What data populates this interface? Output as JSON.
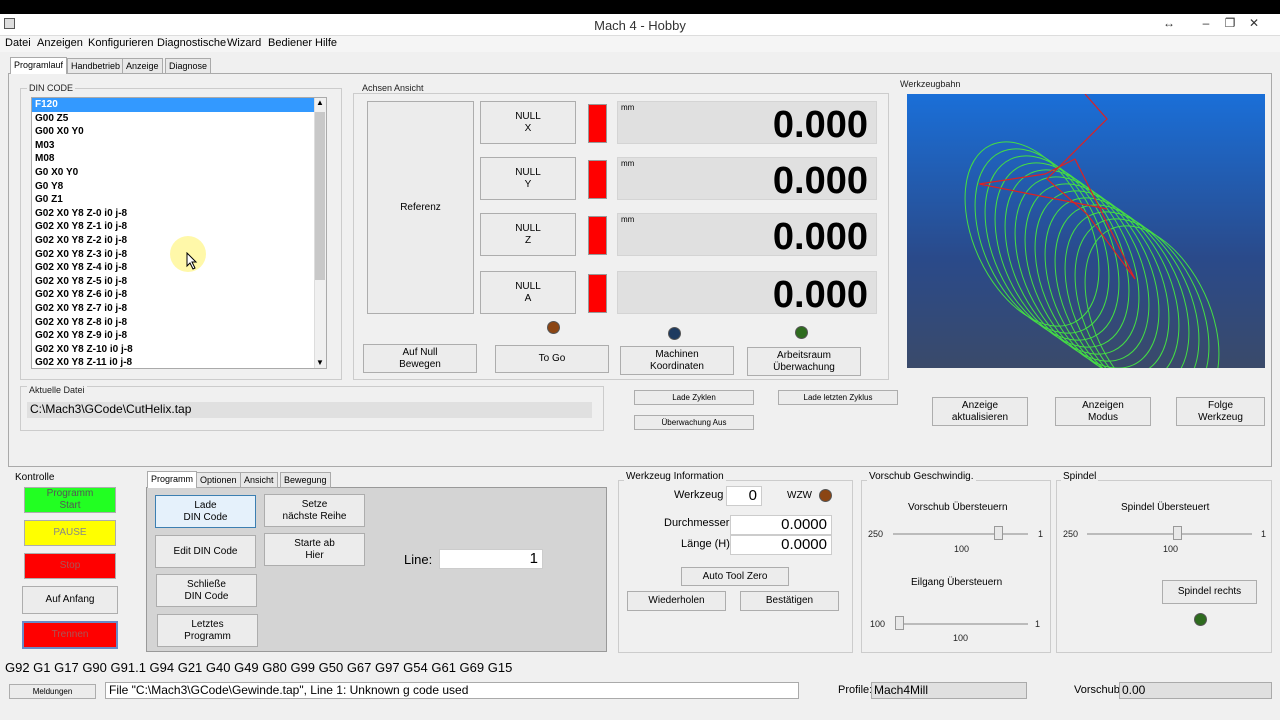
{
  "app": {
    "title": "Mach 4 - Hobby"
  },
  "menu": [
    "Datei",
    "Anzeigen",
    "Konfigurieren",
    "Diagnostische",
    "Wizard",
    "Bediener",
    "Hilfe"
  ],
  "main_tabs": [
    "Programlauf",
    "Handbetrieb",
    "Anzeige",
    "Diagnose"
  ],
  "gcode": {
    "label": "DIN CODE",
    "lines": [
      "F120",
      "G00 Z5",
      "G00 X0 Y0",
      "M03",
      "M08",
      "G0 X0 Y0",
      "G0 Y8",
      "G0 Z1",
      "G02 X0 Y8 Z-0 i0 j-8",
      "G02 X0 Y8 Z-1 i0 j-8",
      "G02 X0 Y8 Z-2 i0 j-8",
      "G02 X0 Y8 Z-3 i0 j-8",
      "G02 X0 Y8 Z-4 i0 j-8",
      "G02 X0 Y8 Z-5 i0 j-8",
      "G02 X0 Y8 Z-6 i0 j-8",
      "G02 X0 Y8 Z-7 i0 j-8",
      "G02 X0 Y8 Z-8 i0 j-8",
      "G02 X0 Y8 Z-9 i0 j-8",
      "G02 X0 Y8 Z-10 i0 j-8",
      "G02 X0 Y8 Z-11 i0 j-8"
    ]
  },
  "axes": {
    "label": "Achsen Ansicht",
    "referenz": "Referenz",
    "rows": [
      {
        "null": "NULL\nX",
        "unit": "mm",
        "value": "0.000"
      },
      {
        "null": "NULL\nY",
        "unit": "mm",
        "value": "0.000"
      },
      {
        "null": "NULL\nZ",
        "unit": "mm",
        "value": "0.000"
      },
      {
        "null": "NULL\nA",
        "unit": "",
        "value": "0.000"
      }
    ],
    "buttons": {
      "auf_null": "Auf Null\nBewegen",
      "to_go": "To Go",
      "maschinen": "Machinen\nKoordinaten",
      "arbeitsraum": "Arbeitsraum\nÜberwachung"
    }
  },
  "toolpath": {
    "label": "Werkzeugbahn"
  },
  "file": {
    "label": "Aktuelle Datei",
    "path": "C:\\Mach3\\GCode\\CutHelix.tap"
  },
  "zyklen": {
    "lade": "Lade Zyklen",
    "lade_letzten": "Lade letzten Zyklus",
    "ueberwachung": "Überwachung Aus"
  },
  "view_buttons": {
    "aktualisieren": "Anzeige\naktualisieren",
    "modus": "Anzeigen\nModus",
    "folge": "Folge\nWerkzeug"
  },
  "kontrolle": {
    "label": "Kontrolle",
    "start": "Programm\nStart",
    "pause": "PAUSE",
    "stop": "Stop",
    "auf_anfang": "Auf Anfang",
    "trennen": "Trennen"
  },
  "sub_tabs": [
    "Programm",
    "Optionen",
    "Ansicht",
    "Bewegung"
  ],
  "programm": {
    "lade": "Lade\nDIN Code",
    "edit": "Edit DIN Code",
    "schliesse": "Schließe\nDIN Code",
    "letztes": "Letztes\nProgramm",
    "setze": "Setze\nnächste Reihe",
    "starte": "Starte ab\nHier",
    "line_label": "Line:",
    "line_value": "1"
  },
  "werkzeug": {
    "label": "Werkzeug Information",
    "werkzeug_label": "Werkzeug",
    "werkzeug_value": "0",
    "wzw": "WZW",
    "durchmesser_label": "Durchmesser",
    "durchmesser_value": "0.0000",
    "laenge_label": "Länge (H)",
    "laenge_value": "0.0000",
    "auto": "Auto Tool Zero",
    "wiederholen": "Wiederholen",
    "bestaetigen": "Bestätigen"
  },
  "vorschub": {
    "label": "Vorschub Geschwindig.",
    "feed_title": "Vorschub Übersteuern",
    "feed_min": "250",
    "feed_max": "1",
    "feed_value": "100",
    "feed_level": 0.8,
    "rapid_title": "Eilgang Übersteuern",
    "rapid_min": "100",
    "rapid_max": "1",
    "rapid_value": "100",
    "rapid_level": 0.0
  },
  "spindel": {
    "label": "Spindel",
    "title": "Spindel Übersteuert",
    "min": "250",
    "max": "1",
    "value": "100",
    "level": 0.55,
    "rechts": "Spindel rechts"
  },
  "status": {
    "gcodes": "G92 G1 G17 G90 G91.1 G94 G21 G40 G49 G80 G99 G50 G67 G97 G54 G61 G69 G15",
    "meldungen": "Meldungen",
    "message": "File \"C:\\Mach3\\GCode\\Gewinde.tap\", Line 1: Unknown g code used",
    "profile_label": "Profile:",
    "profile_value": "Mach4Mill",
    "vorschub_label": "Vorschub",
    "vorschub_value": "0.00"
  },
  "colors": {
    "green": "#22ff22",
    "yellow": "#ffff00",
    "red": "#ff0000",
    "dro_bg": "#e0e0e0",
    "led_brown": "#8b4513",
    "led_blue": "#1e3a5f",
    "led_green": "#2e6b1e"
  }
}
